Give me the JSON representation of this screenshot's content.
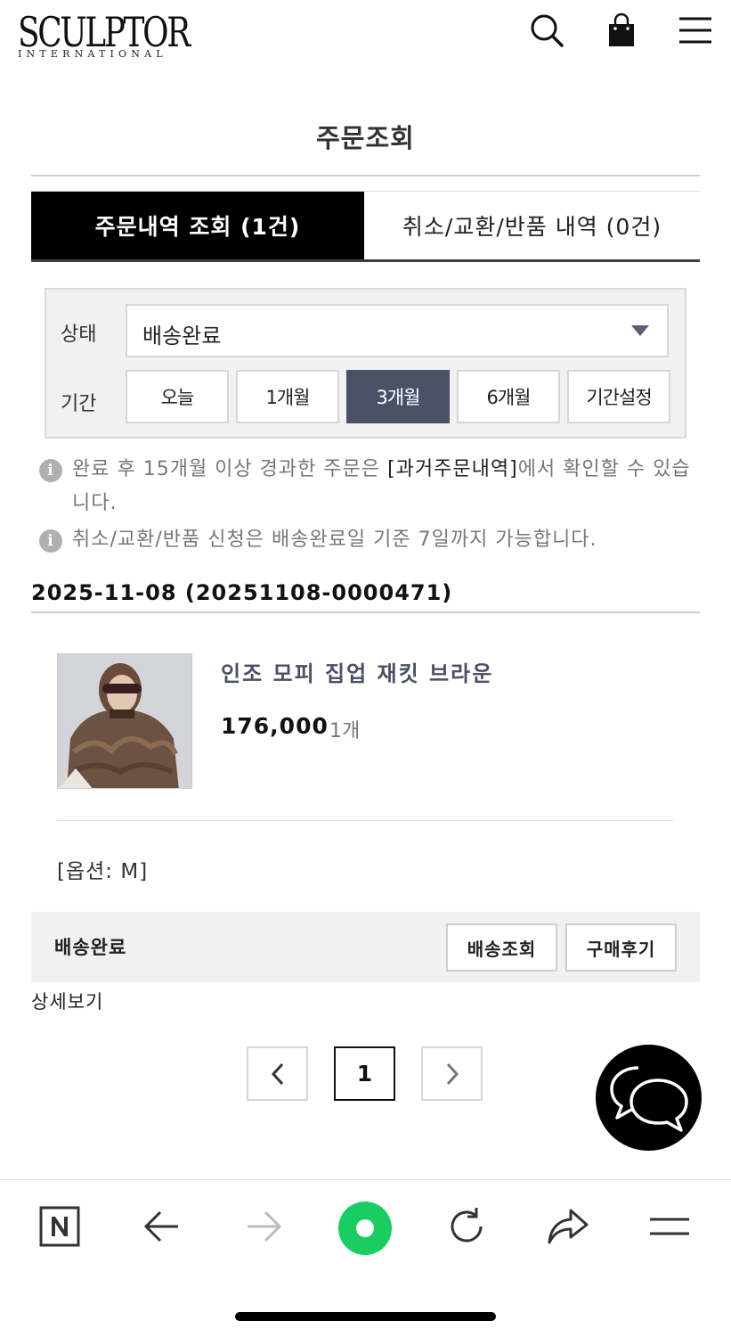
{
  "header": {
    "logo_main": "SCULPTOR",
    "logo_sub": "INTERNATIONAL",
    "icons": [
      "search-icon",
      "bag-icon",
      "menu-icon"
    ]
  },
  "page_title": "주문조회",
  "tabs": [
    {
      "label": "주문내역 조회 (1건)",
      "active": true
    },
    {
      "label": "취소/교환/반품 내역 (0건)",
      "active": false
    }
  ],
  "filter": {
    "status_label": "상태",
    "status_value": "배송완료",
    "period_label": "기간",
    "periods": [
      "오늘",
      "1개월",
      "3개월",
      "6개월",
      "기간설정"
    ],
    "selected_period": "3개월"
  },
  "notes": {
    "note1_pre": "완료 후 15개월 이상 경과한 주문은 ",
    "note1_link": "[과거주문내역]",
    "note1_post": "에서 확인할 수 있습니다.",
    "note2": "취소/교환/반품 신청은 배송완료일 기준 7일까지 가능합니다."
  },
  "order": {
    "date_header": "2025-11-08 (20251108-0000471)",
    "product_name": "인조 모피 집업 재킷 브라운",
    "price": "176,000",
    "quantity": "1개",
    "option": "[옵션: M]",
    "status": "배송완료",
    "track_button": "배송조회",
    "review_button": "구매후기",
    "detail_link": "상세보기"
  },
  "pagination": {
    "current_page": "1"
  },
  "toolbar": {
    "icons": [
      "naver-icon",
      "back-icon",
      "forward-icon",
      "green-dot-icon",
      "refresh-icon",
      "share-icon",
      "menu-icon"
    ]
  },
  "colors": {
    "accent_dark": "#4a5066",
    "active_tab": "#000000",
    "product_name": "#4a5066",
    "naver_green": "#19ce60"
  }
}
